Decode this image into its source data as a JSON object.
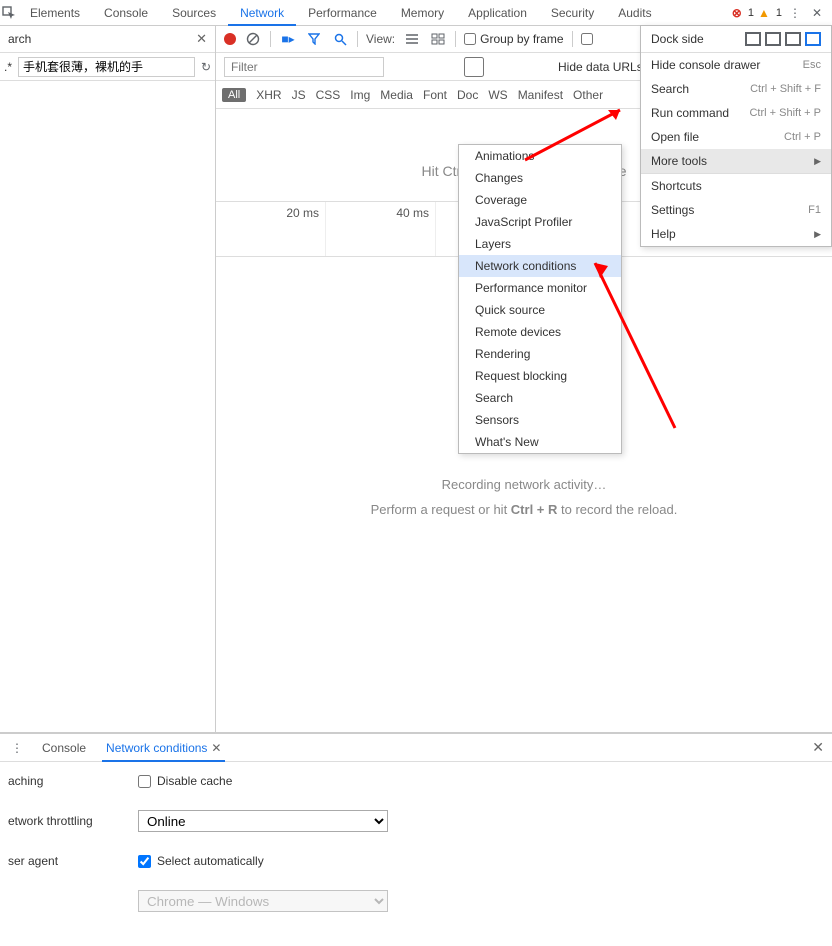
{
  "tabs": {
    "elements": "Elements",
    "console": "Console",
    "sources": "Sources",
    "network": "Network",
    "performance": "Performance",
    "memory": "Memory",
    "application": "Application",
    "security": "Security",
    "audits": "Audits"
  },
  "errcount": "1",
  "warncount": "1",
  "leftpane": {
    "search_label": "arch",
    "filter_value": "手机套很薄，裸机的手"
  },
  "toolbar": {
    "view_label": "View:",
    "group_label": "Group by frame"
  },
  "filterbar": {
    "filter_placeholder": "Filter",
    "hide_label": "Hide data URLs"
  },
  "types": {
    "all": "All",
    "xhr": "XHR",
    "js": "JS",
    "css": "CSS",
    "img": "Img",
    "media": "Media",
    "font": "Font",
    "doc": "Doc",
    "ws": "WS",
    "manifest": "Manifest",
    "other": "Other"
  },
  "content": {
    "hint": "Hit Ctrl + R to reload and capture",
    "t20": "20 ms",
    "t40": "40 ms",
    "rec1": "Recording network activity…",
    "rec2a": "Perform a request or hit ",
    "rec2b": "Ctrl + R",
    "rec2c": " to record the reload."
  },
  "mainmenu": {
    "dockside": "Dock side",
    "hide_drawer": "Hide console drawer",
    "hide_drawer_sc": "Esc",
    "search": "Search",
    "search_sc": "Ctrl + Shift + F",
    "run": "Run command",
    "run_sc": "Ctrl + Shift + P",
    "open": "Open file",
    "open_sc": "Ctrl + P",
    "more": "More tools",
    "shortcuts": "Shortcuts",
    "settings": "Settings",
    "settings_sc": "F1",
    "help": "Help"
  },
  "submenu": {
    "animations": "Animations",
    "changes": "Changes",
    "coverage": "Coverage",
    "jsprofiler": "JavaScript Profiler",
    "layers": "Layers",
    "netcond": "Network conditions",
    "perfmon": "Performance monitor",
    "quicksrc": "Quick source",
    "remote": "Remote devices",
    "rendering": "Rendering",
    "reqblock": "Request blocking",
    "search": "Search",
    "sensors": "Sensors",
    "whatsnew": "What's New"
  },
  "drawer": {
    "console_tab": "Console",
    "netcond_tab": "Network conditions",
    "caching": "aching",
    "disable_cache": "Disable cache",
    "throttling": "etwork throttling",
    "online": "Online",
    "useragent": "ser agent",
    "select_auto": "Select automatically",
    "ua_value": "Chrome — Windows"
  }
}
